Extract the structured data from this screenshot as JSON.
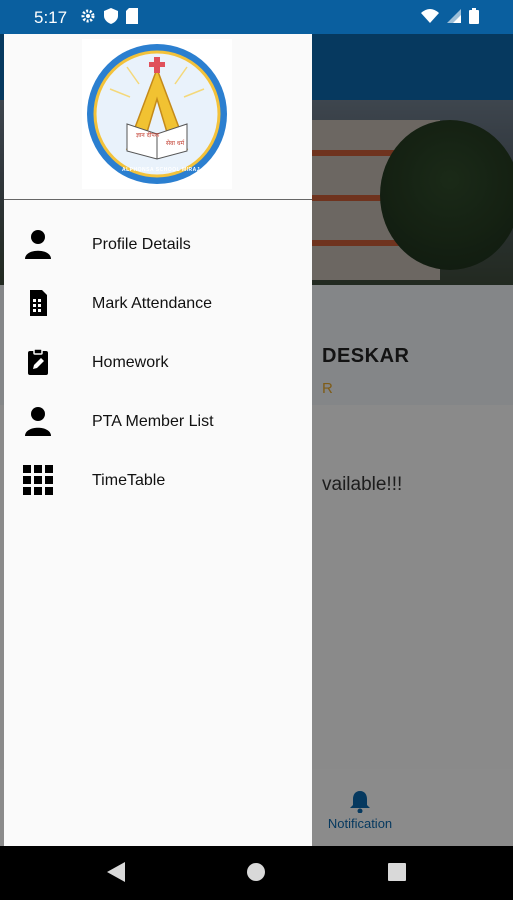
{
  "status_bar": {
    "time": "5:17",
    "bg_color": "#0a5f9f"
  },
  "background_app": {
    "profile_name_partial": "DESKAR",
    "profile_role_partial": "R",
    "empty_message_partial": "vailable!!!",
    "bottom_nav": {
      "notification_label": "Notification"
    }
  },
  "drawer": {
    "logo": {
      "banner_text_top": "ज्ञान दीपक",
      "banner_text_bottom": "सेवा धर्म",
      "ring_text": "ALPHONSA SCHOOL MIRAJ"
    },
    "menu": [
      {
        "label": "Profile Details",
        "icon": "person-icon"
      },
      {
        "label": "Mark Attendance",
        "icon": "document-icon"
      },
      {
        "label": "Homework",
        "icon": "clipboard-edit-icon"
      },
      {
        "label": "PTA Member List",
        "icon": "person-icon"
      },
      {
        "label": "TimeTable",
        "icon": "grid-icon"
      }
    ]
  },
  "colors": {
    "primary": "#0b65a8",
    "accent": "#e0a22a",
    "drawer_bg": "#fafafa"
  }
}
